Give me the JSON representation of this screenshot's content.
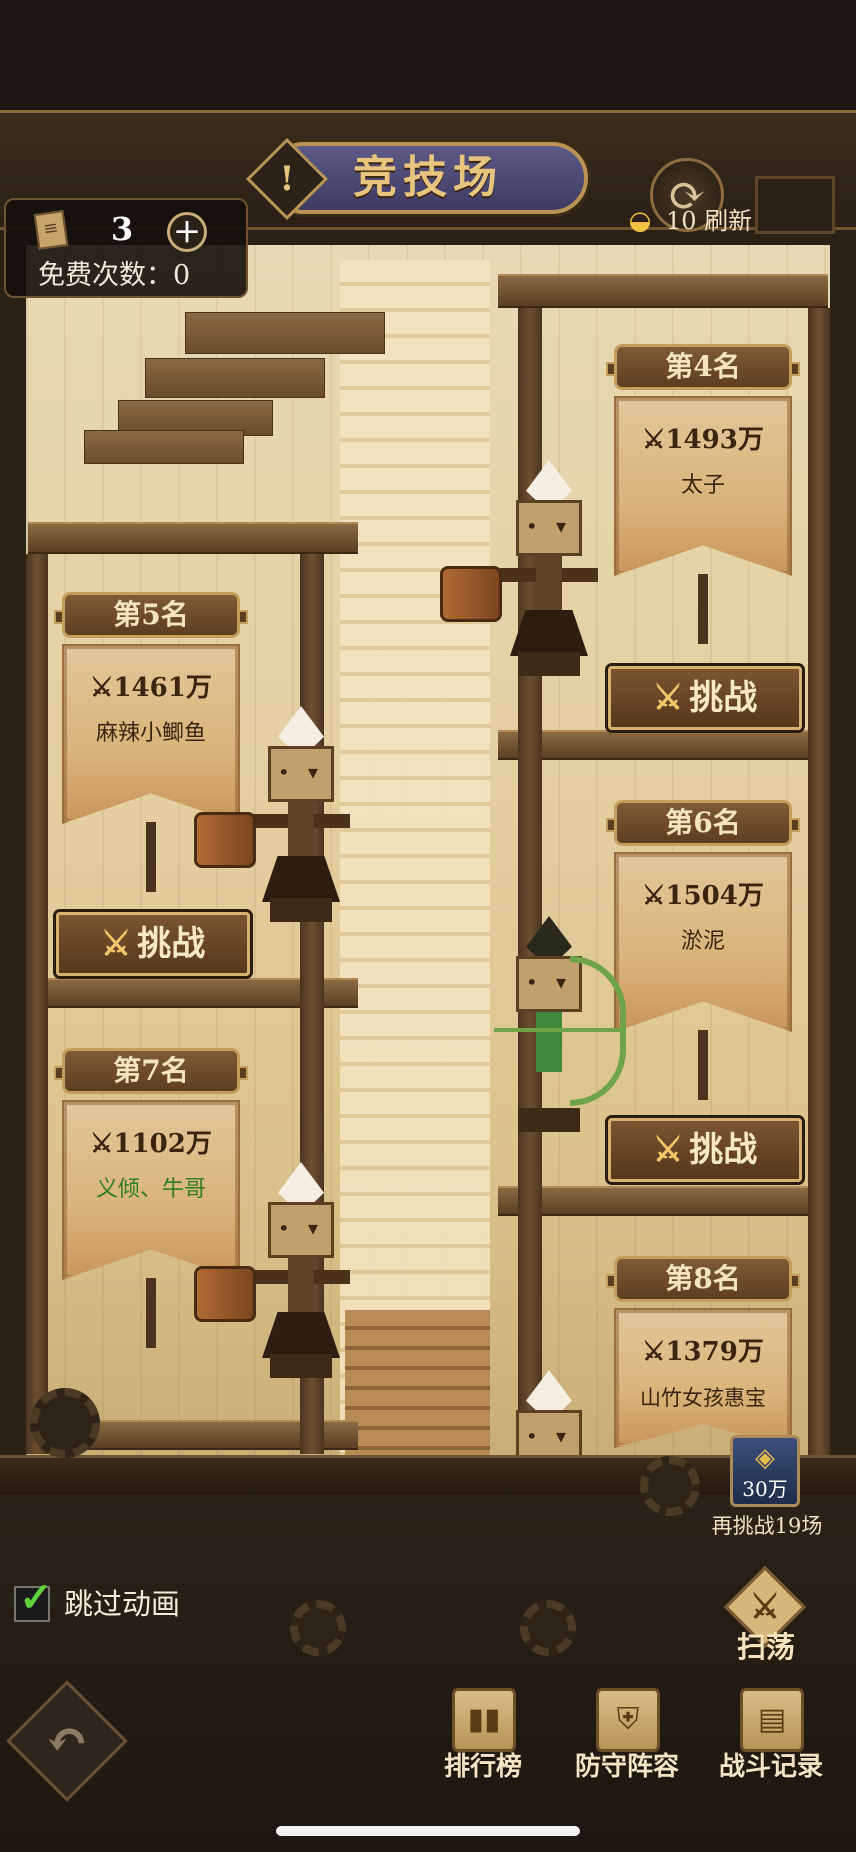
{
  "header": {
    "title": "竞技场",
    "info_glyph": "!"
  },
  "refresh": {
    "cost_icon": "gold-ingot-icon",
    "label": "10 刷新",
    "icon": "refresh-icon"
  },
  "tickets": {
    "count": "3",
    "plus": "+",
    "free_label": "免费次数：0"
  },
  "opponents": [
    {
      "rank_label": "第4名",
      "power": "1493万",
      "name": "太子",
      "name_color": "#3b2510"
    },
    {
      "rank_label": "第5名",
      "power": "1461万",
      "name": "麻辣小鲫鱼",
      "name_color": "#3b2510"
    },
    {
      "rank_label": "第6名",
      "power": "1504万",
      "name": "淤泥",
      "name_color": "#3b2510"
    },
    {
      "rank_label": "第7名",
      "power": "1102万",
      "name": "义倾、牛哥",
      "name_color": "#2e7d1f"
    },
    {
      "rank_label": "第8名",
      "power": "1379万",
      "name": "山竹女孩惠宝",
      "name_color": "#3b2510"
    }
  ],
  "challenge_label": "挑战",
  "power_icon": "crossed-swords-icon",
  "rechallenge": {
    "coin_label": "30万",
    "label": "再挑战19场"
  },
  "skip_animation": {
    "label": "跳过动画",
    "checked": true
  },
  "sweep": {
    "label": "扫荡"
  },
  "nav": {
    "back_glyph": "↶",
    "ranking": "排行榜",
    "defense": "防守阵容",
    "battle_log": "战斗记录"
  }
}
